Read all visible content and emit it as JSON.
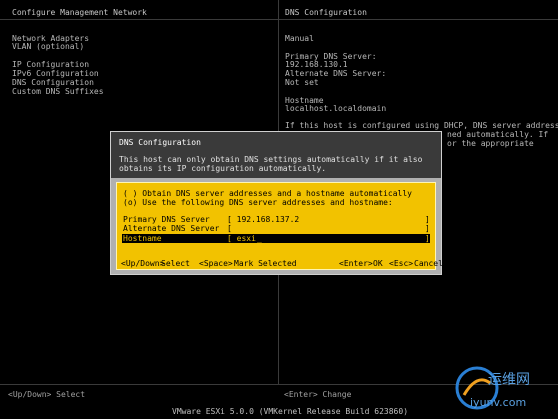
{
  "left_panel": {
    "title": "Configure Management Network",
    "menu": [
      "Network Adapters",
      "VLAN (optional)",
      "",
      "IP Configuration",
      "IPv6 Configuration",
      "DNS Configuration",
      "Custom DNS Suffixes"
    ],
    "hint": "<Up/Down> Select"
  },
  "right_panel": {
    "title": "DNS Configuration",
    "mode": "Manual",
    "primary_label": "Primary DNS Server:",
    "primary_value": "192.168.130.1",
    "alternate_label": "Alternate DNS Server:",
    "alternate_value": "Not set",
    "hostname_label": "Hostname",
    "hostname_value": "localhost.localdomain",
    "info_line1": "If this host is configured using DHCP, DNS server addresses",
    "info_line2": "ned automatically. If",
    "info_line3": "or the appropriate",
    "hint": "<Enter> Change"
  },
  "dialog": {
    "title": "DNS Configuration",
    "message": "This host can only obtain DNS settings automatically if it also obtains its IP configuration automatically.",
    "option_auto": "( ) Obtain DNS server addresses and a hostname automatically",
    "option_manual": "(o) Use the following DNS server addresses and hostname:",
    "primary_label": "Primary DNS Server",
    "primary_value": "[ 192.168.137.2",
    "primary_end": "]",
    "alternate_label": "Alternate DNS Server",
    "alternate_value": "[",
    "alternate_end": "]",
    "hostname_label": "Hostname",
    "hostname_value": "[ esxi",
    "hostname_cursor": "_",
    "hostname_end": "]",
    "footer": {
      "nav": "<Up/Down>",
      "nav_text": "Select",
      "space": "<Space>",
      "space_text": "Mark Selected",
      "enter": "<Enter>",
      "enter_text": "OK",
      "esc": "<Esc>",
      "esc_text": "Cancel"
    }
  },
  "status_bar": "VMware ESXi 5.0.0 (VMKernel Release Build 623860)",
  "watermark": {
    "cn": "运维网",
    "url": "iyunv.com"
  },
  "colors": {
    "background": "#000000",
    "dialog_body": "#f2c200",
    "dialog_header": "#3a3a3a"
  }
}
